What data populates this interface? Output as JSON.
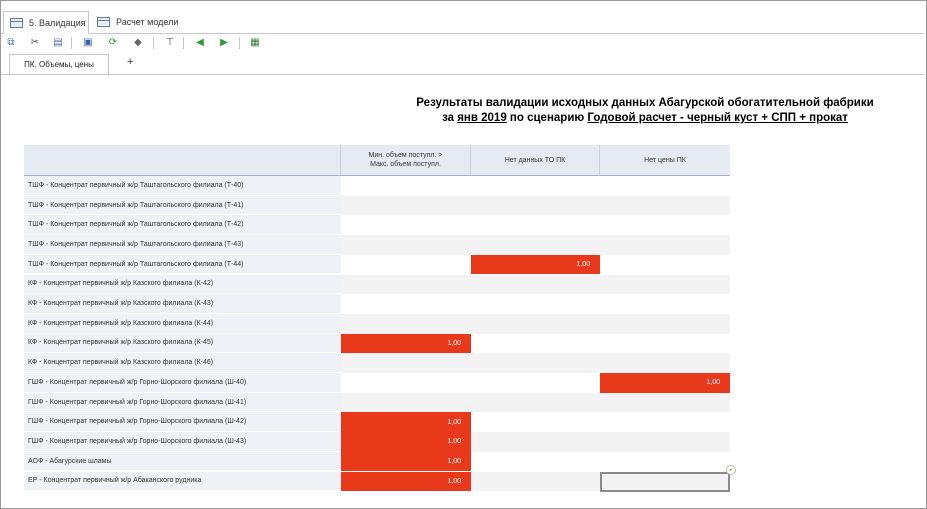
{
  "doc_tabs": [
    {
      "label": "5. Валидация",
      "active": true
    },
    {
      "label": "Расчет модели",
      "active": false
    }
  ],
  "toolbar_icons": [
    "copy-icon",
    "cut-icon",
    "paste-icon",
    "save-icon",
    "refresh-icon",
    "eraser-icon",
    "filter-icon",
    "arrow-left-icon",
    "arrow-right-icon",
    "export-icon"
  ],
  "sheet_tabs": {
    "active": "ПК. Объемы, цены",
    "add": "+"
  },
  "title": {
    "line1": "Результаты валидации исходных данных Абагурской обогатительной фабрики",
    "prefix": "за ",
    "period": "янв 2019",
    "middle": " по сценарию ",
    "scenario": "Годовой расчет - черный куст + СПП + прокат"
  },
  "columns": [
    {
      "label": "Мин. объем поступл. >\nМакс. объем поступл."
    },
    {
      "label": "Нет данных ТО ПК"
    },
    {
      "label": "Нет цены ПК"
    }
  ],
  "rows": [
    {
      "label": "ТШФ - Концентрат первичный ж/р Таштагольского филиала (Т-40)",
      "cells": [
        "",
        "",
        ""
      ]
    },
    {
      "label": "ТШФ - Концентрат первичный ж/р Таштагольского филиала (Т-41)",
      "cells": [
        "",
        "",
        ""
      ]
    },
    {
      "label": "ТШФ - Концентрат первичный ж/р Таштагольского филиала (Т-42)",
      "cells": [
        "",
        "",
        ""
      ]
    },
    {
      "label": "ТШФ - Концентрат первичный ж/р Таштагольского филиала (Т-43)",
      "cells": [
        "",
        "",
        ""
      ]
    },
    {
      "label": "ТШФ - Концентрат первичный ж/р Таштагольского филиала (Т-44)",
      "cells": [
        "",
        "1,00",
        ""
      ]
    },
    {
      "label": "КФ - Концентрат первичный ж/р Казского филиала (К-42)",
      "cells": [
        "",
        "",
        ""
      ]
    },
    {
      "label": "КФ - Концентрат первичный ж/р Казского филиала (К-43)",
      "cells": [
        "",
        "",
        ""
      ]
    },
    {
      "label": "КФ - Концентрат первичный ж/р Казского филиала (К-44)",
      "cells": [
        "",
        "",
        ""
      ]
    },
    {
      "label": "КФ - Концентрат первичный ж/р Казского филиала (К-45)",
      "cells": [
        "1,00",
        "",
        ""
      ]
    },
    {
      "label": "КФ - Концентрат первичный ж/р Казского филиала (К-46)",
      "cells": [
        "",
        "",
        ""
      ]
    },
    {
      "label": "ГШФ - Концентрат первичный ж/р Горно-Шорского филиала (Ш-40)",
      "cells": [
        "",
        "",
        "1,00"
      ]
    },
    {
      "label": "ГШФ - Концентрат первичный ж/р Горно-Шорского филиала (Ш-41)",
      "cells": [
        "",
        "",
        ""
      ]
    },
    {
      "label": "ГШФ - Концентрат первичный ж/р Горно-Шорского филиала (Ш-42)",
      "cells": [
        "1,00",
        "",
        ""
      ]
    },
    {
      "label": "ГШФ - Концентрат первичный ж/р Горно-Шорского филиала (Ш-43)",
      "cells": [
        "1,00",
        "",
        ""
      ]
    },
    {
      "label": "АОФ - Абагурские шламы",
      "cells": [
        "1,00",
        "",
        ""
      ]
    },
    {
      "label": "ЕР - Концентрат первичный ж/р Абаканского рудника",
      "cells": [
        "1,00",
        "",
        ""
      ]
    }
  ],
  "colors": {
    "flag": "#e8391b",
    "header": "#e6ebf3",
    "label_bg": "#eef1f6"
  }
}
